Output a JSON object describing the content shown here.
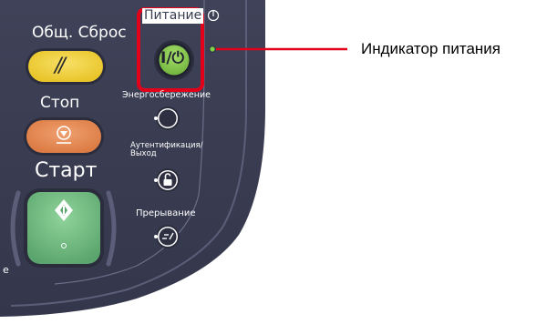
{
  "panel": {
    "reset_label": "Общ. Сброс",
    "reset_button_glyph": "//",
    "stop_label": "Стоп",
    "start_label": "Старт",
    "power_label": "Питание",
    "power_button_glyph": "I/⏻",
    "energy_saver_label": "Энергосбережение",
    "auth_label_line1": "Аутентификация/",
    "auth_label_line2": "Выход",
    "interrupt_label": "Прерывание",
    "partial_left_text": "е"
  },
  "callout": {
    "label": "Индикатор питания"
  },
  "colors": {
    "panel_bg": "#3a3d52",
    "reset_button": "#f2d43a",
    "stop_button": "#e48a53",
    "start_button": "#5ea871",
    "power_button": "#7cbd46",
    "highlight": "#e3001b",
    "indicator_led": "#7ed14a"
  },
  "icons": {
    "power_symbol": "power-symbol-icon",
    "moon": "moon-icon",
    "lock": "lock-icon",
    "interrupt": "interrupt-icon",
    "diamond": "diamond-icon",
    "stop": "stop-icon"
  }
}
